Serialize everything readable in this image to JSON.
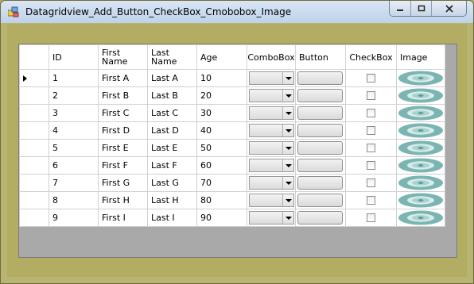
{
  "window": {
    "title": "Datagridview_Add_Button_CheckBox_Cmobobox_Image",
    "controls": [
      "minimize",
      "maximize",
      "close"
    ]
  },
  "grid": {
    "columns": [
      "ID",
      "First Name",
      "Last Name",
      "Age",
      "ComboBox",
      "Button",
      "CheckBox",
      "Image"
    ],
    "current_row": 0,
    "rows": [
      {
        "id": "1",
        "first": "First A",
        "last": "Last A",
        "age": "10",
        "checked": false
      },
      {
        "id": "2",
        "first": "First B",
        "last": "Last B",
        "age": "20",
        "checked": false
      },
      {
        "id": "3",
        "first": "First C",
        "last": "Last C",
        "age": "30",
        "checked": false
      },
      {
        "id": "4",
        "first": "First D",
        "last": "Last D",
        "age": "40",
        "checked": false
      },
      {
        "id": "5",
        "first": "First E",
        "last": "Last E",
        "age": "50",
        "checked": false
      },
      {
        "id": "6",
        "first": "First F",
        "last": "Last F",
        "age": "60",
        "checked": false
      },
      {
        "id": "7",
        "first": "First G",
        "last": "Last G",
        "age": "70",
        "checked": false
      },
      {
        "id": "8",
        "first": "First H",
        "last": "Last H",
        "age": "80",
        "checked": false
      },
      {
        "id": "9",
        "first": "First I",
        "last": "Last I",
        "age": "90",
        "checked": false
      }
    ]
  },
  "icons": {
    "app": "window-app-icon",
    "row_image": "disc-image-icon",
    "current_row": "current-row-arrow-icon"
  },
  "colors": {
    "form_background": "#b3ad63",
    "grid_background": "#a9a9a9",
    "image_teal": "#7bb5b2"
  }
}
